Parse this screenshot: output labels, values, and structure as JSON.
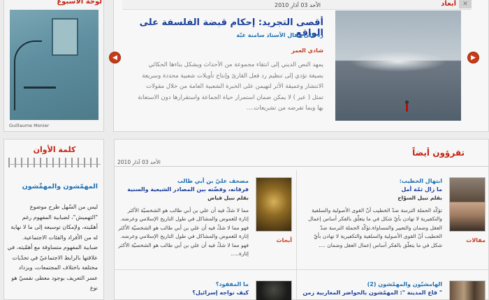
{
  "feature": {
    "header_label": "أبعاد",
    "date": "الأحد 03 آذار 2010",
    "title": "أقصى التجريد: إحكام قبضة الفلسفة على الواقع",
    "subtitle": "رد على مقال الأستاذ سامنة غبّة",
    "author": "شادي العمر",
    "body": "يمهد النص الديني إلى انتقاء مجموعة من الأحداث ويشكل بناءها الحكائي بصيغة تؤدي إلى تنظيم رد فعل القارئ وإنتاج تأويلات شعبية محددة وسريعة الانتشار وعميقة الأثر لتهيمن على الخبرة الشعبية العامة من خلال مقولات تمثل ( عبر ) لا يمكن ضمان استمرار حياة الجماعة واستقرارها دون الاستعانة بها وبما تفرضه من تشريعات...."
  },
  "painting": {
    "header_label": "لوحة الأسبوع",
    "credit": "Guillaume Monier"
  },
  "word_of_time": {
    "title": "كلمة الأوان",
    "heading": "المهمّشون والمهمِّشون",
    "body": "ليس من السّهل طرح موضوع \"التهميش\"، لضبابية المفهوم رغم أهمّيته، ولإمكان توسيعه إلى ما لا نهاية له من الأفراد والفئات الاجتماعية. ضبابية المفهوم متساوقة مع أهمّيته، في علاقتها بالرابط الاجتماعيّ في تحدّيات مختلفة باختلاف المجتمعات، ويزداد عسر التعريف بوجود معطى نفسيّ هو نوع"
  },
  "also_read": {
    "title": "تقرؤون أيضاً",
    "date": "الأحد 03 آذار 2010",
    "cards": [
      {
        "category": "مقالات",
        "title": "ابتهال الخطيب:",
        "subtitle": "ما زال ثمّة أمل",
        "author": "بقلم نبيل السوّاح",
        "body": "تؤكّد الحملة الترسة ضدّ الخطيب أنّ القوى الأصولية والسلفية والتكفيرية لا تهادن بأيّ شكل في ما يتعلّق بالفكر أساس إعمال العقل وضمان والتعبير والمساواة.تؤكّد الحملة الترسة ضدّ الخطيب أنّ القوى الأصولية والسلفية والتكفيرية لا تهادن بأيّ شكل في ما يتعلّق بالفكر أساس إعمال العقل وضمان ...."
      },
      {
        "category": "أبحاث",
        "title": "مصحف عليّ بن أبي طالب",
        "subtitle": "فرقانه، وفضّته بين المصادر الشيعية والسنية",
        "author": "بقلم نبيل فياض",
        "body": "مما لا شكّ فيه أن علي بن أبي طالب هو الشخصيّة الأكثر إثارة للغموض والمشاكل في طول التاريخ الإسلامي وعرضه. فهو مما لا شكّ فيه أن علي بن أبي طالب هو الشخصيّة الأكثر إثارة للغموض والمشاكل في طول التاريخ الإسلامي وعرضه. فهو مما لا شكّ فيه أن علي بن أبي طالب هو الشخصيّة الأكثر إثارة....."
      },
      {
        "category": "",
        "title": "الهامشيّون والمهمّشون (2)",
        "subtitle": "\" قاع المدينة \": المهمّشون بالحواضر المغاربية زمن",
        "author": "",
        "body": ""
      },
      {
        "category": "",
        "title": "ما المفقود؟",
        "subtitle": "كيف نواجه إسرائيل؟",
        "author": "",
        "body": ""
      }
    ]
  },
  "colors": {
    "accent_red": "#c62312",
    "link_blue": "#1b6fb5",
    "arrow_orange": "#c73a18"
  }
}
